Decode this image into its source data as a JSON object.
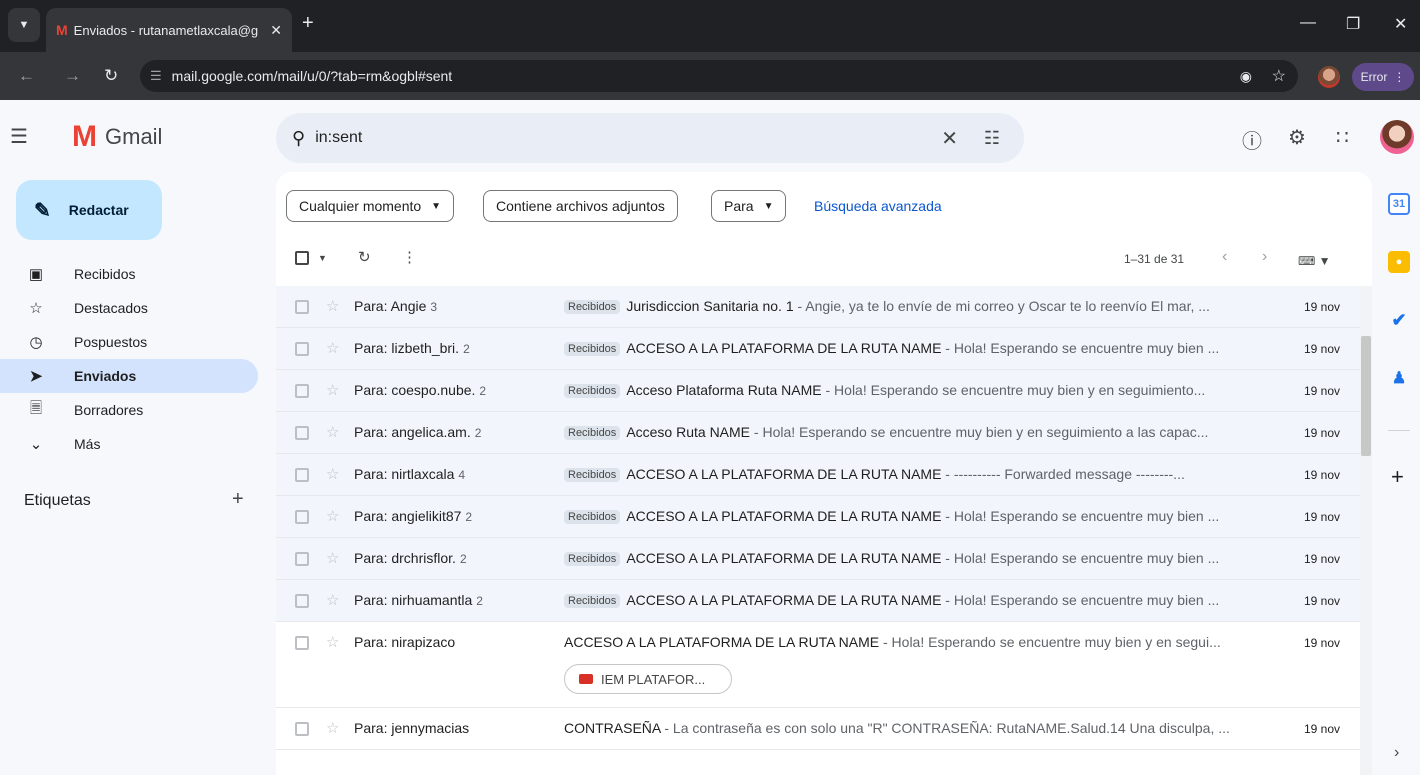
{
  "browser": {
    "tab_title": "Enviados - rutanametlaxcala@g",
    "url": "mail.google.com/mail/u/0/?tab=rm&ogbl#sent",
    "error_label": "Error"
  },
  "app": {
    "name": "Gmail"
  },
  "search": {
    "query": "in:sent"
  },
  "sidebar": {
    "compose_label": "Redactar",
    "items": [
      {
        "label": "Recibidos",
        "icon": "inbox-icon"
      },
      {
        "label": "Destacados",
        "icon": "star-icon"
      },
      {
        "label": "Pospuestos",
        "icon": "clock-icon"
      },
      {
        "label": "Enviados",
        "icon": "send-icon",
        "active": true
      },
      {
        "label": "Borradores",
        "icon": "draft-icon"
      },
      {
        "label": "Más",
        "icon": "chevron-down-icon"
      }
    ],
    "labels_title": "Etiquetas"
  },
  "filters": {
    "chips": [
      "Cualquier momento",
      "Contiene archivos adjuntos",
      "Para"
    ],
    "advanced_search": "Búsqueda avanzada"
  },
  "toolbar": {
    "pager": "1–31 de 31"
  },
  "emails": [
    {
      "to": "Para: Angie",
      "count": "3",
      "label": "Recibidos",
      "subject": "Jurisdiccion Sanitaria no. 1",
      "snippet": " - Angie, ya te lo envíe de mi correo y Oscar te lo reenvío El mar, ...",
      "date": "19 nov"
    },
    {
      "to": "Para: lizbeth_bri.",
      "count": "2",
      "label": "Recibidos",
      "subject": "ACCESO A LA PLATAFORMA DE LA RUTA NAME",
      "snippet": " - Hola! Esperando se encuentre muy bien ...",
      "date": "19 nov"
    },
    {
      "to": "Para: coespo.nube.",
      "count": "2",
      "label": "Recibidos",
      "subject": "Acceso Plataforma Ruta NAME",
      "snippet": " - Hola! Esperando se encuentre muy bien y en seguimiento...",
      "date": "19 nov"
    },
    {
      "to": "Para: angelica.am.",
      "count": "2",
      "label": "Recibidos",
      "subject": "Acceso Ruta NAME",
      "snippet": " - Hola! Esperando se encuentre muy bien y en seguimiento a las capac...",
      "date": "19 nov"
    },
    {
      "to": "Para: nirtlaxcala",
      "count": "4",
      "label": "Recibidos",
      "subject": "ACCESO A LA PLATAFORMA DE LA RUTA NAME",
      "snippet": " - ---------- Forwarded message --------...",
      "date": "19 nov"
    },
    {
      "to": "Para: angielikit87",
      "count": "2",
      "label": "Recibidos",
      "subject": "ACCESO A LA PLATAFORMA DE LA RUTA NAME",
      "snippet": " - Hola! Esperando se encuentre muy bien ...",
      "date": "19 nov"
    },
    {
      "to": "Para: drchrisflor.",
      "count": "2",
      "label": "Recibidos",
      "subject": "ACCESO A LA PLATAFORMA DE LA RUTA NAME",
      "snippet": " - Hola! Esperando se encuentre muy bien ...",
      "date": "19 nov"
    },
    {
      "to": "Para: nirhuamantla",
      "count": "2",
      "label": "Recibidos",
      "subject": "ACCESO A LA PLATAFORMA DE LA RUTA NAME",
      "snippet": " - Hola! Esperando se encuentre muy bien ...",
      "date": "19 nov"
    },
    {
      "to": "Para: nirapizaco",
      "count": "",
      "label": "",
      "subject": "ACCESO A LA PLATAFORMA DE LA RUTA NAME",
      "snippet": " - Hola! Esperando se encuentre muy bien y en segui...",
      "date": "19 nov",
      "attachment": "IEM PLATAFOR..."
    },
    {
      "to": "Para: jennymacias",
      "count": "",
      "label": "",
      "subject": "CONTRASEÑA",
      "snippet": " - La contraseña es con solo una \"R\" CONTRASEÑA: RutaNAME.Salud.14 Una disculpa, ...",
      "date": "19 nov"
    }
  ],
  "colors": {
    "accent": "#0b57d0",
    "compose_bg": "#c2e7ff",
    "active_nav": "#d3e3fd"
  }
}
